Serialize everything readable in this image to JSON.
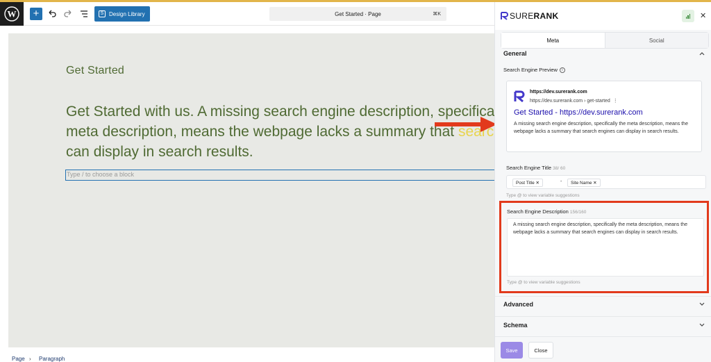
{
  "toolbar": {
    "design_library_label": "Design Library",
    "command_label": "Get Started · Page",
    "command_shortcut": "⌘K"
  },
  "editor": {
    "title": "Get Started",
    "paragraph_main": "Get Started with us. A missing search engine description, specifically the meta description, means the webpage lacks a summary that ",
    "paragraph_highlight": "search",
    "paragraph_end": " engines can display in search results.",
    "block_placeholder": "Type / to choose a block"
  },
  "statusbar": {
    "items": [
      "Page",
      "Paragraph"
    ]
  },
  "panel": {
    "brand_light": "SURE",
    "brand_bold": "RANK",
    "tabs": [
      {
        "label": "Meta",
        "active": true
      },
      {
        "label": "Social",
        "active": false
      }
    ],
    "general": {
      "title": "General",
      "preview_label": "Search Engine Preview",
      "preview": {
        "site": "https://dev.surerank.com",
        "url": "https://dev.surerank.com › get-started",
        "menu": "⋮",
        "title": "Get Started - https://dev.surerank.com",
        "description": "A missing search engine description, specifically the meta description, means the webpage lacks a summary that search engines can display in search results."
      },
      "title_field": {
        "label": "Search Engine Title",
        "count": "38/ 60",
        "chips": [
          "Post Title",
          "Site Name"
        ],
        "separator": "-",
        "hint": "Type @ to view variable suggestions"
      },
      "description_field": {
        "label": "Search Engine Description",
        "count": "156/160",
        "value": "A missing search engine description, specifically the meta description, means the webpage lacks a summary that search engines can display in search results.",
        "hint": "Type @ to view variable suggestions"
      }
    },
    "advanced_label": "Advanced",
    "schema_label": "Schema",
    "save_label": "Save",
    "close_label": "Close"
  },
  "colors": {
    "accent": "#2271b1",
    "heading_green": "#4f6a33",
    "highlight": "#e8d44d",
    "annotation_red": "#e23a1c",
    "save_purple": "#9b8ae6",
    "link_blue": "#1a0dab"
  }
}
